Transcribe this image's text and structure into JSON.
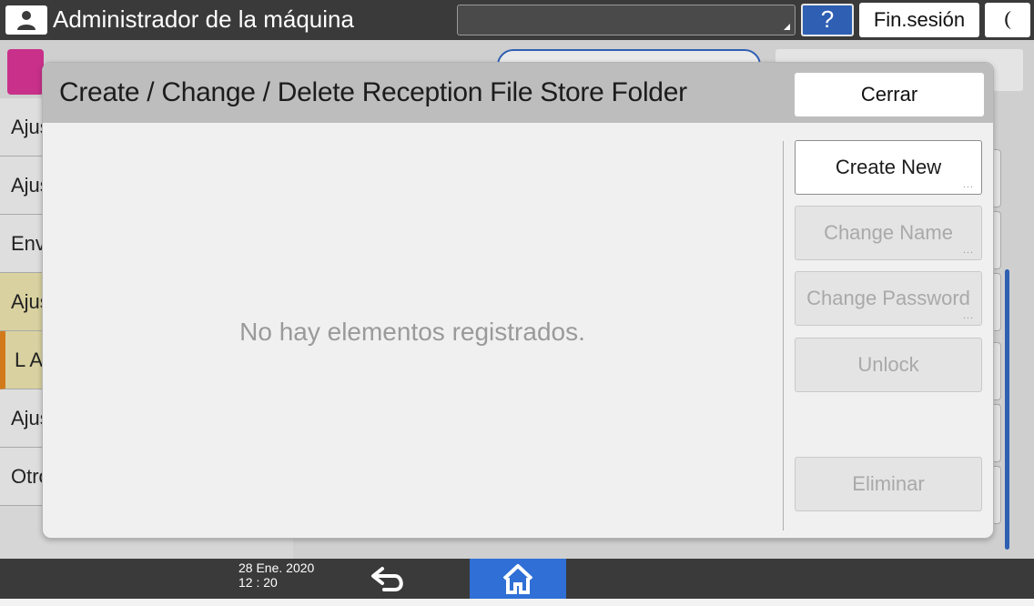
{
  "topbar": {
    "title": "Administrador de la máquina",
    "help_label": "?",
    "logout_label": "Fin.sesión"
  },
  "background": {
    "items": [
      "Ajus",
      "Ajus",
      "Envi",
      "Ajus",
      "L A",
      "Ajus",
      "Otro"
    ]
  },
  "dialog": {
    "title": "Create / Change / Delete Reception File Store Folder",
    "close_label": "Cerrar",
    "empty_message": "No hay elementos registrados.",
    "buttons": [
      {
        "label": "Create New",
        "enabled": true,
        "more": true
      },
      {
        "label": "Change Name",
        "enabled": false,
        "more": true
      },
      {
        "label": "Change Password",
        "enabled": false,
        "more": true
      },
      {
        "label": "Unlock",
        "enabled": false,
        "more": false
      },
      {
        "label": "Eliminar",
        "enabled": false,
        "more": false
      }
    ],
    "more_glyph": "..."
  },
  "bottombar": {
    "date": "28 Ene. 2020",
    "time": "12 : 20"
  },
  "colors": {
    "accent": "#2f5fb3",
    "home": "#2f6fd6",
    "fax": "#c8308a",
    "selected_item": "#d9d2a0"
  },
  "icons": {
    "user": "user-icon",
    "help": "question-icon",
    "sleep": "moon-icon",
    "back": "back-arrow-icon",
    "home": "home-icon",
    "fax": "fax-icon"
  }
}
